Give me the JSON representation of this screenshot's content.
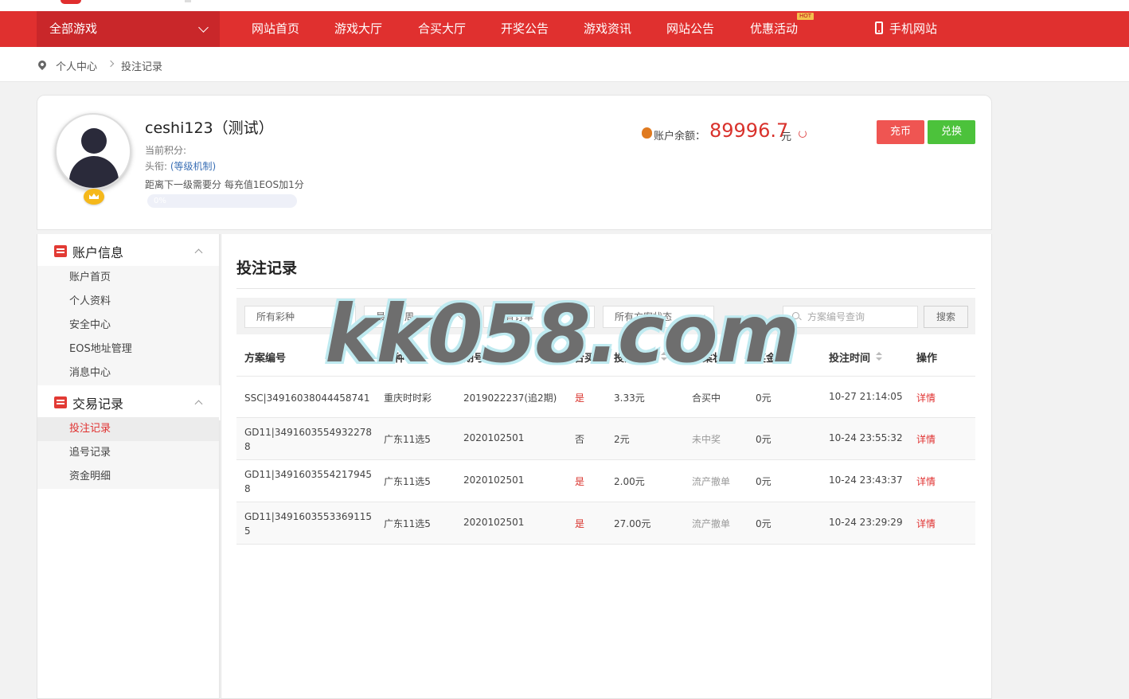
{
  "nav": {
    "all_games": "全部游戏",
    "items": [
      "网站首页",
      "游戏大厅",
      "合买大厅",
      "开奖公告",
      "游戏资讯",
      "网站公告",
      "优惠活动"
    ],
    "hot_badge": "HOT",
    "mobile": "手机网站"
  },
  "breadcrumb": {
    "home": "个人中心",
    "current": "投注记录"
  },
  "profile": {
    "username": "ceshi123（测试）",
    "points_label": "当前积分:",
    "title_label": "头衔:",
    "level_link": "(等级机制)",
    "next_level": "距离下一级需要分 每充值1EOS加1分",
    "progress_text": "0%",
    "progress_value": 0,
    "balance_label": "账户余额：",
    "balance_value": "89996.7",
    "balance_unit": "元",
    "charge_button": "充币",
    "exchange_button": "兑换"
  },
  "sidebar": {
    "account": {
      "title": "账户信息",
      "items": [
        "账户首页",
        "个人资料",
        "安全中心",
        "EOS地址管理",
        "消息中心"
      ]
    },
    "trade": {
      "title": "交易记录",
      "items": [
        "投注记录",
        "追号记录",
        "资金明细"
      ]
    }
  },
  "main": {
    "title": "投注记录",
    "filters": {
      "lottery": "所有彩种",
      "period": "最近一周",
      "orders": "所有订单",
      "status": "所有方案状态",
      "search_placeholder": "方案编号查询",
      "search_button": "搜索"
    },
    "columns": [
      "方案编号",
      "彩种",
      "期号",
      "合买",
      "投注金额",
      "方案状态",
      "奖金",
      "投注时间",
      "操作"
    ],
    "rows": [
      {
        "id": "SSC|34916038044458741",
        "lottery": "重庆时时彩",
        "issue": "2019022237(追2期)",
        "joint": "是",
        "amount": "3.33元",
        "status": "合买中",
        "prize": "0元",
        "time": "10-27 21:14:05",
        "action": "详情"
      },
      {
        "id": "GD11|34916035549322788",
        "lottery": "广东11选5",
        "issue": "2020102501",
        "joint": "否",
        "amount": "2元",
        "status": "未中奖",
        "prize": "0元",
        "time": "10-24 23:55:32",
        "action": "详情"
      },
      {
        "id": "GD11|34916035542179458",
        "lottery": "广东11选5",
        "issue": "2020102501",
        "joint": "是",
        "amount": "2.00元",
        "status": "流产撤单",
        "prize": "0元",
        "time": "10-24 23:43:37",
        "action": "详情"
      },
      {
        "id": "GD11|34916035533691155",
        "lottery": "广东11选5",
        "issue": "2020102501",
        "joint": "是",
        "amount": "27.00元",
        "status": "流产撤单",
        "prize": "0元",
        "time": "10-24 23:29:29",
        "action": "详情"
      }
    ]
  },
  "watermark": "kk058.com",
  "colors": {
    "brand_red": "#e0302f",
    "nav_dark": "#c9272a",
    "balance_red": "#d9322c",
    "exchange_green": "#4cc23b",
    "charge_red": "#ef5552"
  }
}
